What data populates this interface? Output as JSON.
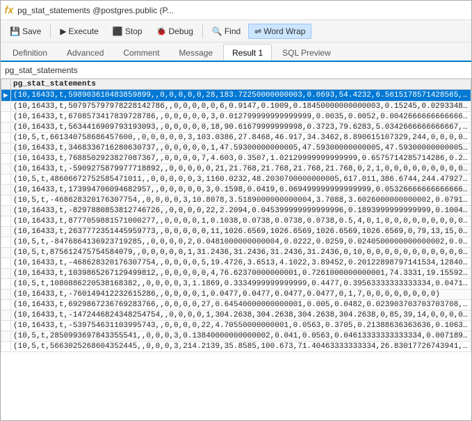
{
  "titleBar": {
    "icon": "fx",
    "text": "pg_stat_statements @postgres.public (P..."
  },
  "toolbar": {
    "save_label": "Save",
    "execute_label": "Execute",
    "stop_label": "Stop",
    "debug_label": "Debug",
    "find_label": "Find",
    "word_wrap_label": "Word Wrap"
  },
  "tabs": [
    {
      "id": "definition",
      "label": "Definition"
    },
    {
      "id": "advanced",
      "label": "Advanced"
    },
    {
      "id": "comment",
      "label": "Comment"
    },
    {
      "id": "message",
      "label": "Message"
    },
    {
      "id": "result1",
      "label": "Result 1",
      "active": true
    },
    {
      "id": "sql-preview",
      "label": "SQL Preview"
    }
  ],
  "objectBar": {
    "object_name": "pg_stat_statements"
  },
  "tableHeader": "pg_stat_statements",
  "rows": [
    "(10,16433,t,598903610483859899,,0,0,0,0,0,28,183.72250000000003,0.0693,54.4232,6.5615178571428565,12.836724343434506,1",
    "(10,16433,t,507975797978228142786,,0,0,0,0,0,6,0.9147,0.1009,0.18450000000000003,0.15245,0.029334891057123995,22,395,0,0",
    "(10,16433,t,670857341783972878​6,,0,0,0,0,0,3,0.012799999999999999,0.0035,0.0052,0.00426666666666666,0.00070395706939",
    "(10,16433,t,5634416909793193093,,0,0,0,0,0,18,90.61679999999998,0.3723,79.6283,5.0342666666666667,18.09336109768​1964,14",
    "(10,5,t,66134075868645760​0,,0,0,0,0,0,3,103.0386,27.8468,46.917,34.3462,8.890615107329,244,0,0,0,0,0,0,0,0,0,0,0,0,0,",
    "(10,16433,t,3468336716280630737,,0,0,0,0,0,1,47.59300000000005,47.59300000000005,47.59300000000005,47.59300000000005,",
    "(10,16433,t,76885029​23827087367,,0,0,0,0,7,4.603,0.3507,1.02129999999999999,0.657571428571​4286,0.24544304963116167,55",
    "(10,16433,t,-590927587997771​​​8892,,0,0,0,0,0,21,21.768,21.768,21.768,21.768,0,2,1,0,0,0,0,0,0,0,0,0,0,0,0,0,0,0,0,0",
    "(10,5,t,486066727525854710​11,,0,0,0,0,0,3,1160.0232,48.2030700000000005,617.011,386.6744,244.4792749504​2734,39,27,3,0,0",
    "(10,16433,t,173994706094​682957,,0,0,0,0,0,3,0.1598,0.0419,0.069499999999999999,0.0532666666666666​64,0.0117814354907295",
    "(10,5,t,-468628320176307754,,0,0,0,0,3,10.8078,3.5189000000000004,3.7088,3.6026000000000002,0.079​142024234​91559,7353",
    "(10,16433,t,-829788085381274​6726,,0,0,0,0,22,2.2094,0.0453999999999​99996,0.1893999999999999,0.100427272727​273,0.0",
    "(10,16433,t,8777059881571000277,,0,0,0,0,1,0.1038,0.0738,0.0738,0.0738,0.5,4,0,1,0,0,0,0,0,0,0,0,0,0,0,0,0)",
    "(10,16433,t,263777235​14​45959773,,0,0,0,0,0,11,1026.6569,1026.6569,1026.6569,1026.6569,0,79,13,15,0,0,0,0,0,0,0,0,0,35,16",
    "(10,5,t,-847686413692​37192​85,,0,0,0,0,2,0.0481000000000004,0.0222,0.0259,0.0240500000000000002,0.00185,0,6,0,0,0,0,",
    "(10,5,t,87561247575​4584079,,0,0,0,0,0,1,31.2436,31.2436,31.2436,31.2436,0,10,0,0,0,0,0,0,0,0,0,0,0,0,0,0)",
    "(10,16433,t,-468628320176307754,,0,0,0,0,5,19.4726,3.6513,4.1022,3.89452,0.20122898797141534,12840,468,0,0,0,0,0,0,0,",
    "(10,16433,t,1039865267129499812,,0,0,0,0,0,4,76.62370000000001,0.7261000000000001,74.3331,19.155924999999996,31.85656",
    "(10,5,t,108088622​0538168382,,0,0,0,0,3,1.1869,0.3334999999999999,0.4477,0.39563333333333334,0.047​16222593936334,630",
    "(10,16433,t,-760149412232615286,,0,0,0,0,1,0.0477,0.0477,0.0477,0.0477,0,1,7,0,0,0,0,0,0,0,0)",
    "(10,16433,t,6929867236769283766,,0,0,0,0,27,0.64540000000000001,0.005,0.0482,0.023903703703703708,0.007525922957130​27",
    "(10,16433,t,-1472446824348254754,,0,0,0,0,1,304.2638,304.2638,304.2638,304.2638,0,85,39,14,0,0,0,0,0,0,22,18,837",
    "(10,16433,t,-539754631103995​743,,0,0,0,0,22,4.70550000000001,0.0563,0.3705,0.21388636363636,0.10631694167336105,",
    "(10,5,t,285099369784335554​1,,0,0,0,3,0.13840000000000002,0.041,0.0563,0.04613333333333334,0.00718903486027​3127,0.2",
    "(10,5,t,5663025268604352445,,0,0,0,3,214.2139,35.8585,100.673,71.40463333333334,26.83017726743941,9765,801,9,0,0,0"
  ]
}
